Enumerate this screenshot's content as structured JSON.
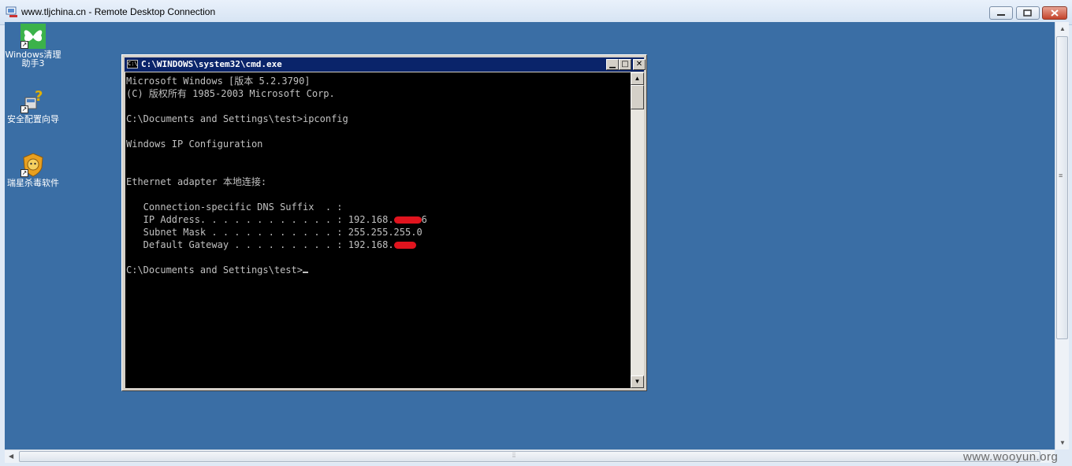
{
  "rdp": {
    "title": "www.tljchina.cn - Remote Desktop Connection"
  },
  "desktop": {
    "background": "#3a6ea5",
    "icons": [
      {
        "label": "Windows清理助手3",
        "icon": "butterfly-icon"
      },
      {
        "label": "安全配置向导",
        "icon": "security-wizard-icon"
      },
      {
        "label": "瑞星杀毒软件",
        "icon": "rising-antivirus-icon"
      }
    ]
  },
  "cmd": {
    "title": "C:\\WINDOWS\\system32\\cmd.exe",
    "lines": [
      "Microsoft Windows [版本 5.2.3790]",
      "(C) 版权所有 1985-2003 Microsoft Corp.",
      "",
      "C:\\Documents and Settings\\test>ipconfig",
      "",
      "Windows IP Configuration",
      "",
      "",
      "Ethernet adapter 本地连接:",
      "",
      "   Connection-specific DNS Suffix  . :",
      "   IP Address. . . . . . . . . . . . : 192.168.",
      "   Subnet Mask . . . . . . . . . . . : 255.255.255.0",
      "   Default Gateway . . . . . . . . . : 192.168.",
      "",
      "C:\\Documents and Settings\\test>"
    ],
    "ip_tail": "6",
    "redaction_color": "#e0141e"
  },
  "watermark": "www.wooyun.org"
}
